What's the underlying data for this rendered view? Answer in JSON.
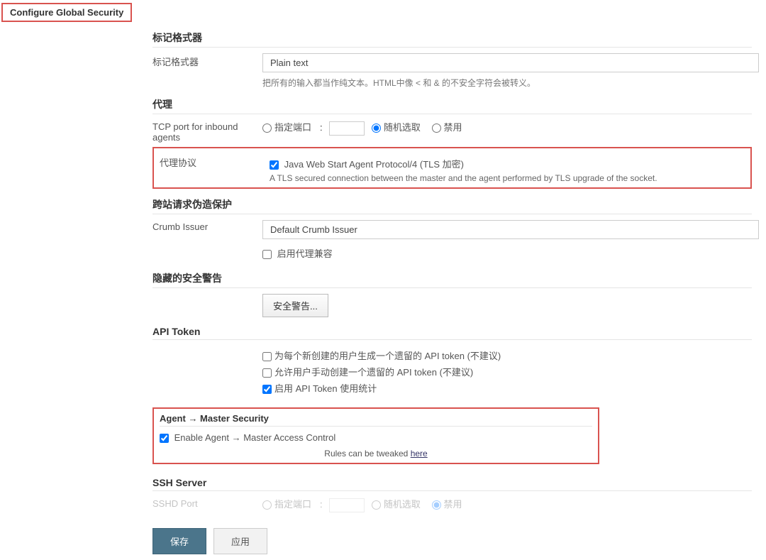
{
  "page": {
    "title": "Configure Global Security"
  },
  "markup": {
    "section": "标记格式器",
    "label": "标记格式器",
    "value": "Plain text",
    "hint": "把所有的输入都当作纯文本。HTML中像 < 和 & 的不安全字符会被转义。"
  },
  "agent": {
    "section": "代理",
    "tcp_label": "TCP port for inbound agents",
    "radio_fixed": "指定端口",
    "radio_random": "随机选取",
    "radio_disable": "禁用",
    "protocol_label": "代理协议",
    "protocol_checkbox": "Java Web Start Agent Protocol/4 (TLS 加密)",
    "protocol_desc": "A TLS secured connection between the master and the agent performed by TLS upgrade of the socket."
  },
  "csrf": {
    "section": "跨站请求伪造保护",
    "crumb_label": "Crumb Issuer",
    "crumb_value": "Default Crumb Issuer",
    "proxy_compat": "启用代理兼容"
  },
  "hidden_warnings": {
    "section": "隐藏的安全警告",
    "button": "安全警告..."
  },
  "api_token": {
    "section": "API Token",
    "opt1": "为每个新创建的用户生成一个遗留的 API token   (不建议)",
    "opt2": "允许用户手动创建一个遗留的 API token   (不建议)",
    "opt3": "启用 API Token 使用统计"
  },
  "agent_master": {
    "section": "Agent → Master Security",
    "enable": "Enable Agent → Master Access Control",
    "rules_prefix": "Rules can be tweaked ",
    "rules_link": "here"
  },
  "ssh": {
    "section": "SSH Server",
    "sshd_label": "SSHD Port",
    "radio_fixed": "指定端口",
    "radio_random": "随机选取",
    "radio_disable": "禁用"
  },
  "buttons": {
    "save": "保存",
    "apply": "应用"
  }
}
